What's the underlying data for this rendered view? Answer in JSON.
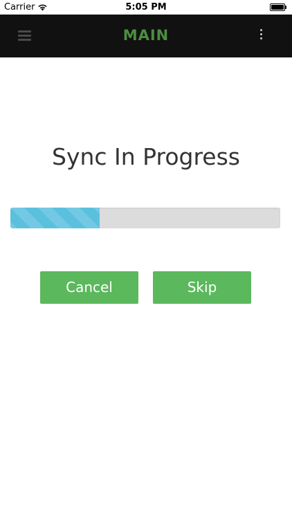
{
  "status_bar": {
    "carrier": "Carrier",
    "time": "5:05 PM",
    "battery_level": 1.0
  },
  "header": {
    "title": "MAIN",
    "title_color": "#4a8f3f",
    "background_color": "#111111",
    "menu_icon": "hamburger-icon",
    "overflow_icon": "more-vertical-icon"
  },
  "main": {
    "title": "Sync In Progress",
    "progress": {
      "fraction": 0.33,
      "fill_color": "#5bc0de",
      "track_color": "#dcdcdc"
    },
    "buttons": {
      "cancel_label": "Cancel",
      "skip_label": "Skip",
      "color": "#5cb85c"
    }
  }
}
